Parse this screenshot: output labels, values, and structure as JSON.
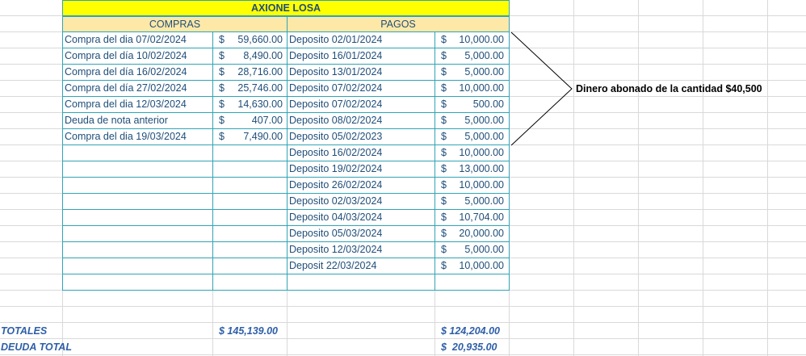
{
  "sheet": {
    "title": "AXIONE LOSA",
    "compras_header": "COMPRAS",
    "pagos_header": "PAGOS",
    "compras": [
      {
        "desc": "Compra del dia 07/02/2024",
        "currency": "$",
        "amount": "59,660.00"
      },
      {
        "desc": "Compra del día 10/02/2024",
        "currency": "$",
        "amount": "8,490.00"
      },
      {
        "desc": "Compra del día 16/02/2024",
        "currency": "$",
        "amount": "28,716.00"
      },
      {
        "desc": "Compra del día 27/02/2024",
        "currency": "$",
        "amount": "25,746.00"
      },
      {
        "desc": "Compra del dia 12/03/2024",
        "currency": "$",
        "amount": "14,630.00"
      },
      {
        "desc": "Deuda de nota anterior",
        "currency": "$",
        "amount": "407.00"
      },
      {
        "desc": "Compra del dia 19/03/2024",
        "currency": "$",
        "amount": "7,490.00"
      }
    ],
    "pagos": [
      {
        "desc": "Deposito 02/01/2024",
        "currency": "$",
        "amount": "10,000.00"
      },
      {
        "desc": "Deposito 16/01/2024",
        "currency": "$",
        "amount": "5,000.00"
      },
      {
        "desc": "Deposito 13/01/2024",
        "currency": "$",
        "amount": "5,000.00"
      },
      {
        "desc": "Deposito 07/02/2024",
        "currency": "$",
        "amount": "10,000.00"
      },
      {
        "desc": "Deposito 07/02/2024",
        "currency": "$",
        "amount": "500.00"
      },
      {
        "desc": "Deposito 08/02/2024",
        "currency": "$",
        "amount": "5,000.00"
      },
      {
        "desc": "Deposito 05/02/2023",
        "currency": "$",
        "amount": "5,000.00"
      },
      {
        "desc": "Deposito 16/02/2024",
        "currency": "$",
        "amount": "10,000.00"
      },
      {
        "desc": "Deposito 19/02/2024",
        "currency": "$",
        "amount": "13,000.00"
      },
      {
        "desc": "Deposito 26/02/2024",
        "currency": "$",
        "amount": "10,000.00"
      },
      {
        "desc": "Deposito 02/03/2024",
        "currency": "$",
        "amount": "5,000.00"
      },
      {
        "desc": "Deposito 04/03/2024",
        "currency": "$",
        "amount": "10,704.00"
      },
      {
        "desc": "Deposito 05/03/2024",
        "currency": "$",
        "amount": "20,000.00"
      },
      {
        "desc": "Deposito 12/03/2024",
        "currency": "$",
        "amount": "5,000.00"
      },
      {
        "desc": "Deposit 22/03/2024",
        "currency": "$",
        "amount": "10,000.00"
      }
    ],
    "totales_label": "TOTALES",
    "totales_compras": "$ 145,139.00",
    "totales_pagos": "$ 124,204.00",
    "deuda_label": "DEUDA TOTAL",
    "deuda_total": "$  20,935.00",
    "annotation": "Dinero abonado de la cantidad $40,500"
  },
  "colors": {
    "title_bg": "#ffff00",
    "header_bg": "#fde8a8",
    "border": "#31a4b5",
    "text": "#1f4e79"
  }
}
